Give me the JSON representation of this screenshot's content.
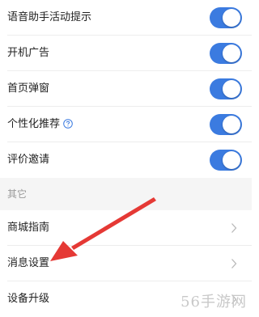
{
  "toggles": [
    {
      "label": "语音助手活动提示",
      "on": true
    },
    {
      "label": "开机广告",
      "on": true
    },
    {
      "label": "首页弹窗",
      "on": true
    },
    {
      "label": "个性化推荐",
      "on": true,
      "help_icon": "question-circle-icon"
    },
    {
      "label": "评价邀请",
      "on": true
    }
  ],
  "section": {
    "title": "其它"
  },
  "links": [
    {
      "label": "商城指南"
    },
    {
      "label": "消息设置"
    },
    {
      "label": "设备升级"
    }
  ],
  "colors": {
    "toggle_on": "#3b7be0",
    "arrow": "#e53935",
    "section_bg": "#f5f5f5"
  },
  "watermark": "56手游网"
}
